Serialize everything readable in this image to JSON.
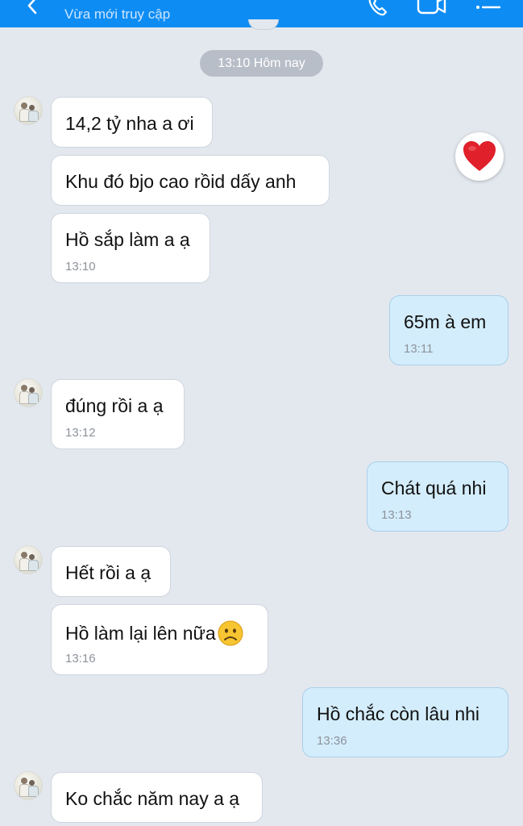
{
  "header": {
    "subtitle": "Vừa mới truy cập",
    "icons": [
      "back-arrow-icon",
      "phone-icon",
      "video-call-icon",
      "menu-list-icon"
    ],
    "color": "#0d8cf4"
  },
  "date_separator": "13:10 Hôm nay",
  "reaction": {
    "icon": "heart-icon",
    "color": "#e0202a"
  },
  "messages": [
    {
      "from": "contact",
      "text": "14,2 tỷ nha a ơi",
      "time": ""
    },
    {
      "from": "contact",
      "text": "Khu đó bjo cao rồid dấy anh",
      "time": ""
    },
    {
      "from": "contact",
      "text": "Hồ sắp làm a ạ",
      "time": "13:10"
    },
    {
      "from": "me",
      "text": "65m à em",
      "time": "13:11"
    },
    {
      "from": "contact",
      "text": "đúng rồi a ạ",
      "time": "13:12"
    },
    {
      "from": "me",
      "text": "Chát quá nhi",
      "time": "13:13"
    },
    {
      "from": "contact",
      "text": "Hết rồi a ạ",
      "time": ""
    },
    {
      "from": "contact",
      "text": "Hồ làm lại lên nữa",
      "emoji": "frowning-face-emoji",
      "time": "13:16"
    },
    {
      "from": "me",
      "text": "Hồ chắc còn lâu nhi",
      "time": "13:36"
    },
    {
      "from": "contact",
      "text": "Ko chắc năm nay a ạ",
      "time": ""
    }
  ]
}
